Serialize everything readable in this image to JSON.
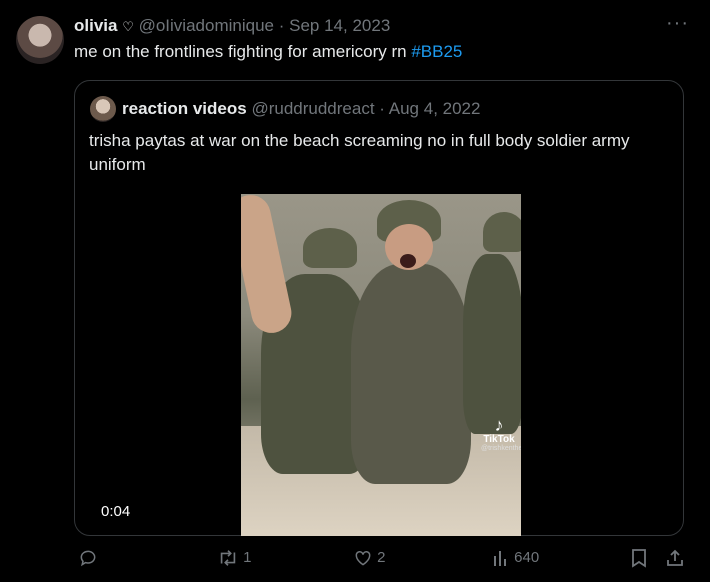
{
  "tweet": {
    "name": "olivia",
    "name_icon": "♡",
    "handle": "@oIiviadominique",
    "separator": "·",
    "date": "Sep 14, 2023",
    "text_main": "me on the frontlines fighting for americory rn ",
    "hashtag": "#BB25",
    "more_label": "···"
  },
  "quote": {
    "name": "reaction videos",
    "handle": "@ruddruddreact",
    "separator": "·",
    "date": "Aug 4, 2022",
    "text": "trisha paytas at war on the beach screaming no in full body soldier army uniform",
    "video_time": "0:04",
    "watermark": "TikTok",
    "watermark_handle": "@trishkenthe"
  },
  "actions": {
    "reply_count": "",
    "retweet_count": "1",
    "like_count": "2",
    "views_count": "640"
  },
  "colors": {
    "accent": "#1d9bf0",
    "muted": "#71767b",
    "text": "#e7e9ea",
    "border": "#333639"
  },
  "icons": [
    "reply-icon",
    "retweet-icon",
    "heart-icon",
    "views-icon",
    "bookmark-icon",
    "share-icon",
    "more-icon",
    "verified-heart-icon",
    "tiktok-icon"
  ]
}
